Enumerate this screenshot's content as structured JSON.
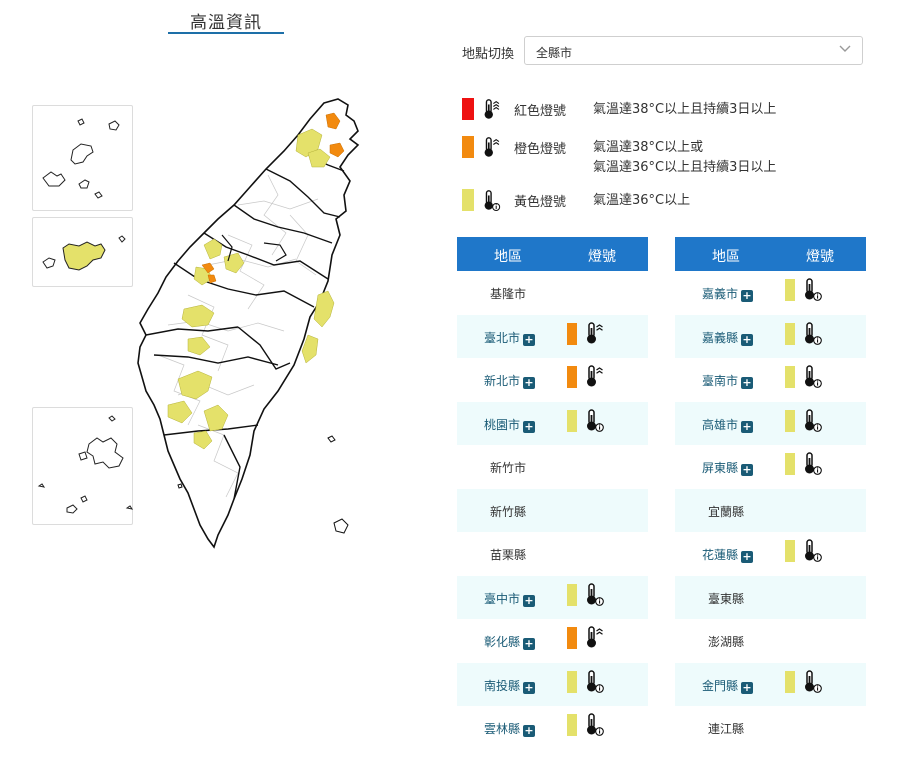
{
  "title": "高溫資訊",
  "location": {
    "label": "地點切換",
    "selected": "全縣市"
  },
  "colors": {
    "red": "#ee1111",
    "orange": "#f28a0f",
    "yellow": "#e4e16a",
    "header": "#1f77c9",
    "link": "#1a5b76"
  },
  "legend": [
    {
      "level": "red",
      "icon": "thermometer-triple-chevron-icon",
      "name": "紅色燈號",
      "desc": [
        "氣溫達38°C以上且持續3日以上"
      ]
    },
    {
      "level": "orange",
      "icon": "thermometer-double-chevron-icon",
      "name": "橙色燈號",
      "desc": [
        "氣溫達38°C以上或",
        "氣溫達36°C以上且持續3日以上"
      ]
    },
    {
      "level": "yellow",
      "icon": "thermometer-info-icon",
      "name": "黃色燈號",
      "desc": [
        "氣溫達36°C以上"
      ]
    }
  ],
  "table_headers": {
    "region": "地區",
    "signal": "燈號"
  },
  "left_table": [
    {
      "name": "基隆市",
      "level": "",
      "expandable": false
    },
    {
      "name": "臺北市",
      "level": "orange",
      "expandable": true
    },
    {
      "name": "新北市",
      "level": "orange",
      "expandable": true
    },
    {
      "name": "桃園市",
      "level": "yellow",
      "expandable": true
    },
    {
      "name": "新竹市",
      "level": "",
      "expandable": false
    },
    {
      "name": "新竹縣",
      "level": "",
      "expandable": false
    },
    {
      "name": "苗栗縣",
      "level": "",
      "expandable": false
    },
    {
      "name": "臺中市",
      "level": "yellow",
      "expandable": true
    },
    {
      "name": "彰化縣",
      "level": "orange",
      "expandable": true
    },
    {
      "name": "南投縣",
      "level": "yellow",
      "expandable": true
    },
    {
      "name": "雲林縣",
      "level": "yellow",
      "expandable": true
    }
  ],
  "right_table": [
    {
      "name": "嘉義市",
      "level": "yellow",
      "expandable": true
    },
    {
      "name": "嘉義縣",
      "level": "yellow",
      "expandable": true
    },
    {
      "name": "臺南市",
      "level": "yellow",
      "expandable": true
    },
    {
      "name": "高雄市",
      "level": "yellow",
      "expandable": true
    },
    {
      "name": "屏東縣",
      "level": "yellow",
      "expandable": true
    },
    {
      "name": "宜蘭縣",
      "level": "",
      "expandable": false
    },
    {
      "name": "花蓮縣",
      "level": "yellow",
      "expandable": true
    },
    {
      "name": "臺東縣",
      "level": "",
      "expandable": false
    },
    {
      "name": "澎湖縣",
      "level": "",
      "expandable": false
    },
    {
      "name": "金門縣",
      "level": "yellow",
      "expandable": true
    },
    {
      "name": "連江縣",
      "level": "",
      "expandable": false
    }
  ]
}
